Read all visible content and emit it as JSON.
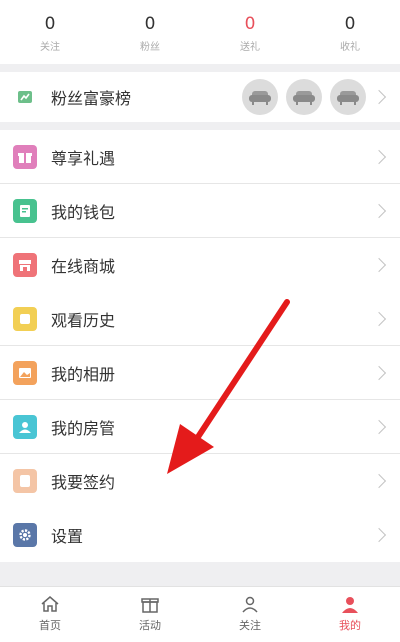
{
  "stats": [
    {
      "value": "0",
      "label": "关注"
    },
    {
      "value": "0",
      "label": "粉丝"
    },
    {
      "value": "0",
      "label": "送礼"
    },
    {
      "value": "0",
      "label": "收礼"
    }
  ],
  "fans_rank": {
    "label": "粉丝富豪榜"
  },
  "group1": [
    {
      "label": "尊享礼遇",
      "icon": "gift-box-icon",
      "color": "#e07fbb"
    },
    {
      "label": "我的钱包",
      "icon": "wallet-icon",
      "color": "#48c28f"
    },
    {
      "label": "在线商城",
      "icon": "store-icon",
      "color": "#ef7378"
    }
  ],
  "group2": [
    {
      "label": "观看历史",
      "icon": "history-icon",
      "color": "#f2cf54"
    },
    {
      "label": "我的相册",
      "icon": "album-icon",
      "color": "#f3a25c"
    },
    {
      "label": "我的房管",
      "icon": "room-admin-icon",
      "color": "#49c5d4"
    },
    {
      "label": "我要签约",
      "icon": "contract-icon",
      "color": "#f4c5a6"
    }
  ],
  "settings": {
    "label": "设置",
    "icon": "gear-icon",
    "color": "#5a77a8"
  },
  "tabbar": [
    {
      "label": "首页",
      "icon": "home-icon"
    },
    {
      "label": "活动",
      "icon": "gift-icon"
    },
    {
      "label": "关注",
      "icon": "follow-icon"
    },
    {
      "label": "我的",
      "icon": "profile-icon"
    }
  ],
  "colors": {
    "accent": "#e8505b",
    "arrow": "#e41b1b"
  }
}
